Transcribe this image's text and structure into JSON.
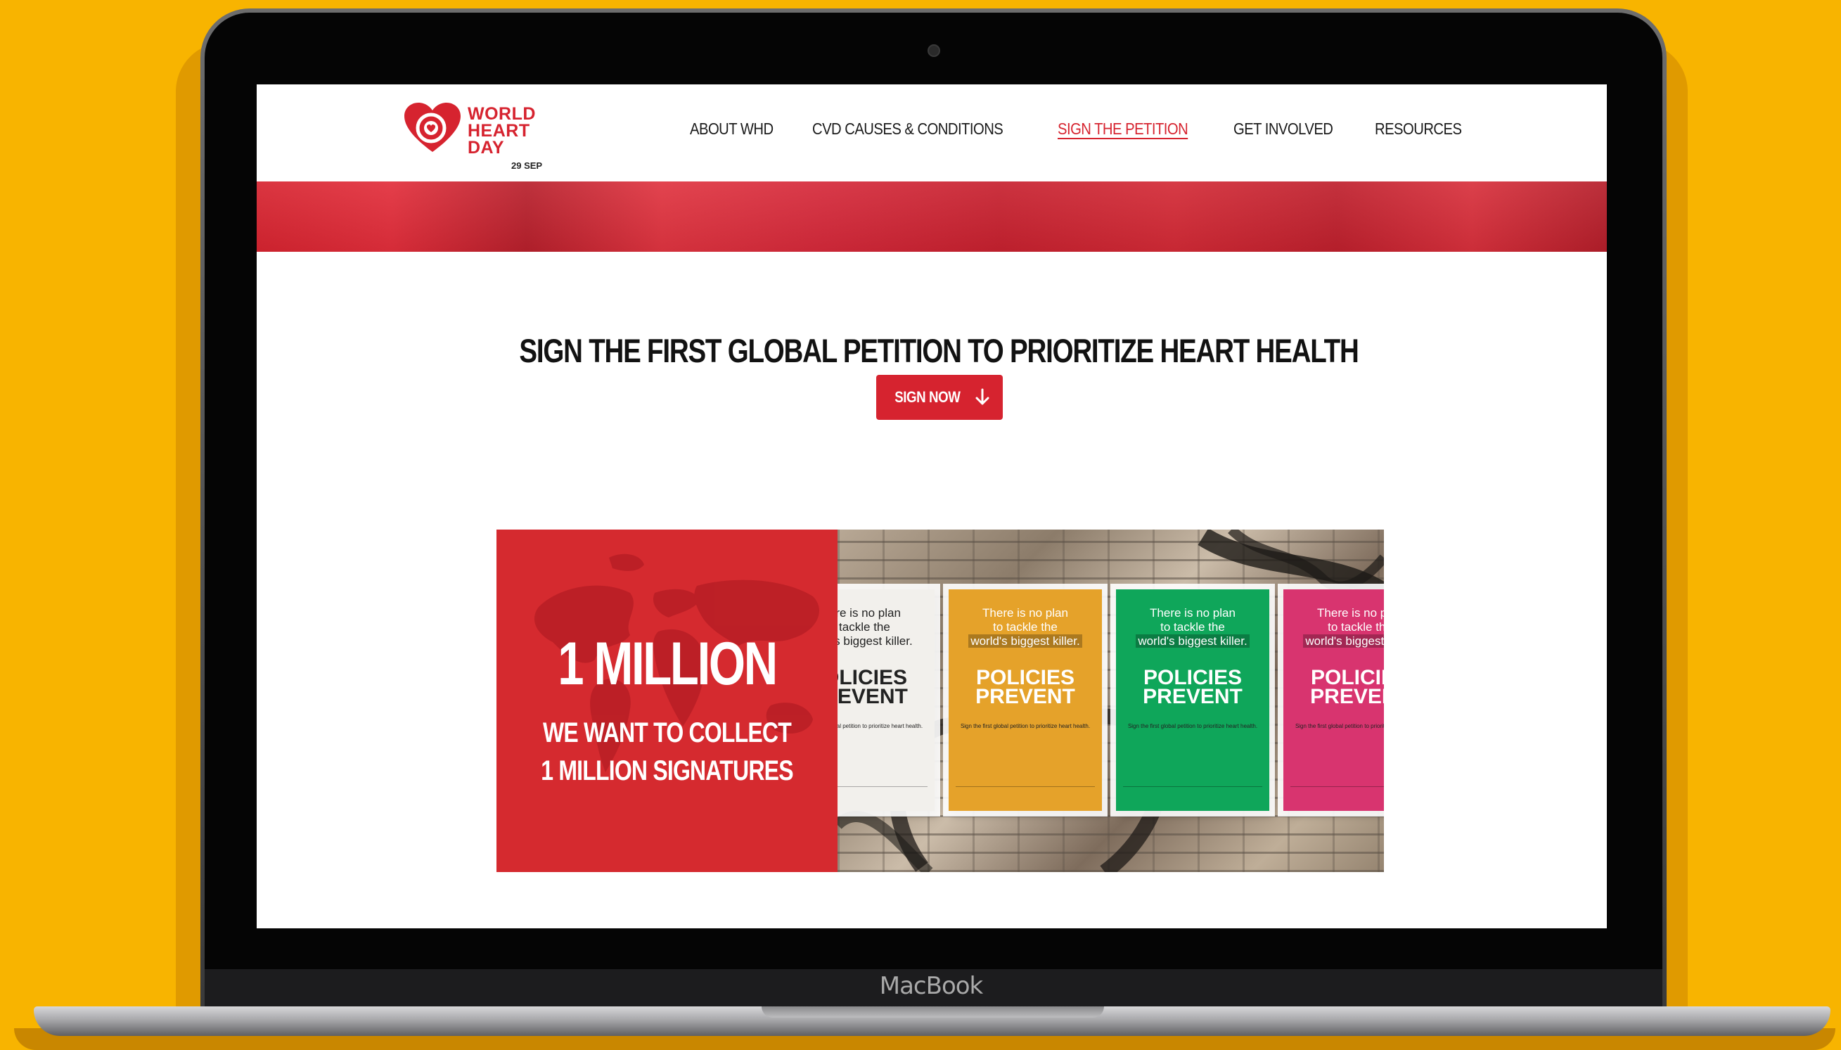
{
  "device": {
    "brand": "MacBook"
  },
  "site": {
    "logo": {
      "line1": "WORLD",
      "line2": "HEART",
      "line3": "DAY",
      "date": "29 SEP"
    },
    "nav": [
      {
        "label": "ABOUT WHD"
      },
      {
        "label": "CVD CAUSES & CONDITIONS"
      },
      {
        "label": "SIGN THE PETITION"
      },
      {
        "label": "GET INVOLVED"
      },
      {
        "label": "RESOURCES"
      }
    ],
    "headline": "SIGN THE FIRST GLOBAL PETITION TO PRIORITIZE HEART HEALTH",
    "cta": {
      "label": "SIGN NOW"
    },
    "feature": {
      "big_number": "1 MILLION",
      "line1": "WE WANT TO COLLECT",
      "line2": "1 MILLION SIGNATURES"
    },
    "posters": {
      "q1": "There is no plan",
      "q2": "to tackle the",
      "q3": "world's biggest killer.",
      "pp1": "POLICIES",
      "pp2": "PREVENT",
      "small": "Sign the first global petition to prioritize heart health."
    }
  },
  "colors": {
    "accent": "#D6232F",
    "background": "#F8B400",
    "poster_yellow": "#E5A22A",
    "poster_green": "#0FA65A",
    "poster_pink": "#D8346F"
  }
}
